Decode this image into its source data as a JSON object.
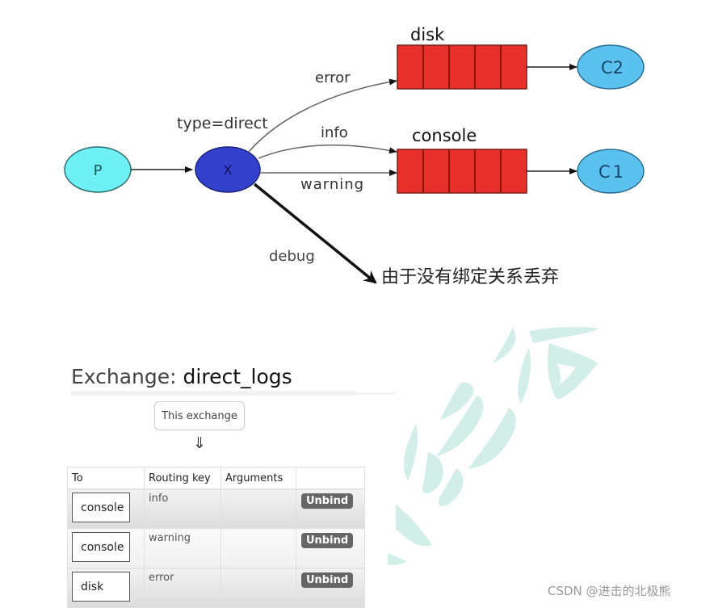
{
  "diagram": {
    "producer": {
      "label": "P",
      "color": "#6ff0f5"
    },
    "exchange": {
      "label": "X",
      "type_label": "type=direct",
      "color": "#3340cc"
    },
    "queues": [
      {
        "name": "disk",
        "consumer": "C2",
        "color": "#e8302a"
      },
      {
        "name": "console",
        "consumer": "C1",
        "color": "#e8302a"
      }
    ],
    "consumer_color": "#5bc2f0",
    "routes": [
      {
        "key": "error",
        "to": "disk"
      },
      {
        "key": "info",
        "to": "console"
      },
      {
        "key": "warning",
        "to": "console"
      },
      {
        "key": "debug",
        "to": "discarded"
      }
    ],
    "discard_note": "由于没有绑定关系丢弃"
  },
  "panel": {
    "title_prefix": "Exchange:",
    "title_name": "direct_logs",
    "source_label": "This exchange",
    "arrow_glyph": "⇓",
    "columns": [
      "To",
      "Routing key",
      "Arguments",
      ""
    ],
    "rows": [
      {
        "to": "console",
        "routing_key": "info",
        "arguments": "",
        "action": "Unbind"
      },
      {
        "to": "console",
        "routing_key": "warning",
        "arguments": "",
        "action": "Unbind"
      },
      {
        "to": "disk",
        "routing_key": "error",
        "arguments": "",
        "action": "Unbind"
      }
    ]
  },
  "watermark": {
    "color": "#d3eee8"
  },
  "footer": {
    "credit": "CSDN @进击的北极熊"
  }
}
